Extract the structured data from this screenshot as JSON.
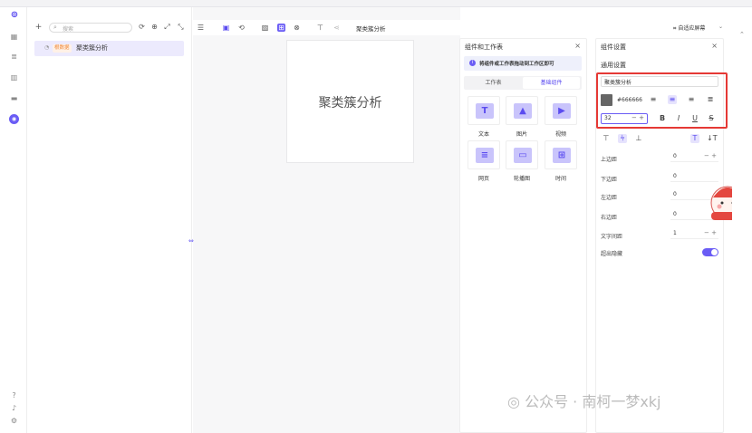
{
  "sidebar": {
    "search_placeholder": "搜索",
    "items": [
      {
        "tag": "根数据",
        "label": "聚类簇分析"
      }
    ]
  },
  "toolbar": {
    "title": "聚类簇分析",
    "screen_mode": "自适应屏幕"
  },
  "canvas": {
    "card_text": "聚类簇分析"
  },
  "components_panel": {
    "title": "组件和工作表",
    "notice": "将组件或工作表拖动到工作区即可",
    "tabs": [
      "工作表",
      "基础组件"
    ],
    "items": [
      {
        "label": "文本",
        "icon": "text-icon"
      },
      {
        "label": "图片",
        "icon": "image-icon"
      },
      {
        "label": "视频",
        "icon": "video-icon"
      },
      {
        "label": "网页",
        "icon": "webpage-icon"
      },
      {
        "label": "轮播图",
        "icon": "carousel-icon"
      },
      {
        "label": "时间",
        "icon": "time-icon"
      }
    ]
  },
  "settings_panel": {
    "title": "组件设置",
    "section": "通用设置",
    "text_value": "聚类簇分析",
    "color_value": "#666666",
    "font_size": "32",
    "rows": [
      {
        "label": "上边距",
        "value": "0"
      },
      {
        "label": "下边距",
        "value": "0"
      },
      {
        "label": "左边距",
        "value": "0"
      },
      {
        "label": "右边距",
        "value": "0"
      },
      {
        "label": "文字间距",
        "value": "1"
      },
      {
        "label": "超出隐藏",
        "value": ""
      }
    ]
  },
  "watermark": "公众号 · 南柯一梦xkj",
  "colors": {
    "accent": "#6a5cf5",
    "highlight_border": "#e53935",
    "swatch": "#666666"
  }
}
